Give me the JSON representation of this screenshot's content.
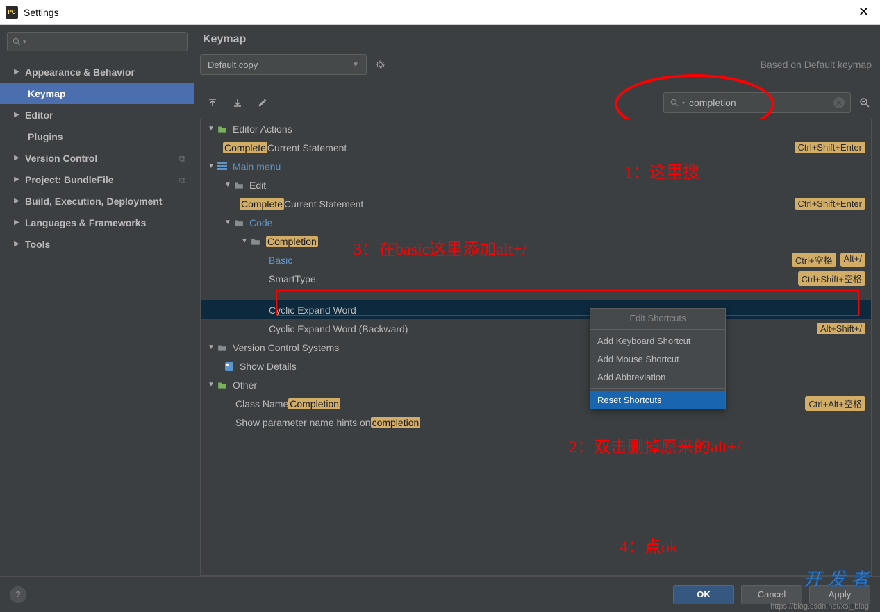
{
  "window": {
    "title": "Settings"
  },
  "sidebar": {
    "items": [
      {
        "label": "Appearance & Behavior",
        "expandable": true,
        "selected": false,
        "level": 0
      },
      {
        "label": "Keymap",
        "expandable": false,
        "selected": true,
        "level": 1
      },
      {
        "label": "Editor",
        "expandable": true,
        "selected": false,
        "level": 0
      },
      {
        "label": "Plugins",
        "expandable": false,
        "selected": false,
        "level": 1
      },
      {
        "label": "Version Control",
        "expandable": true,
        "selected": false,
        "level": 0,
        "doc": true
      },
      {
        "label": "Project: BundleFile",
        "expandable": true,
        "selected": false,
        "level": 0,
        "doc": true
      },
      {
        "label": "Build, Execution, Deployment",
        "expandable": true,
        "selected": false,
        "level": 0
      },
      {
        "label": "Languages & Frameworks",
        "expandable": true,
        "selected": false,
        "level": 0
      },
      {
        "label": "Tools",
        "expandable": true,
        "selected": false,
        "level": 0
      }
    ]
  },
  "keymap": {
    "heading": "Keymap",
    "scheme": "Default copy",
    "basedOn": "Based on Default keymap",
    "search": "completion",
    "tree": {
      "editorActions": {
        "label": "Editor Actions"
      },
      "completeCurrent1": {
        "pre": "",
        "hl": "Complete",
        "post": " Current Statement",
        "shortcut": "Ctrl+Shift+Enter"
      },
      "mainMenu": {
        "label": "Main menu"
      },
      "edit": {
        "label": "Edit"
      },
      "completeCurrent2": {
        "pre": "",
        "hl": "Complete",
        "post": " Current Statement",
        "shortcut": "Ctrl+Shift+Enter"
      },
      "code": {
        "label": "Code"
      },
      "completion": {
        "hl": "Completion"
      },
      "basic": {
        "label": "Basic",
        "shortcut1": "Ctrl+空格",
        "shortcut2": "Alt+/"
      },
      "smartType": {
        "label": "SmartType",
        "shortcut": "Ctrl+Shift+空格"
      },
      "cyclicExpand": {
        "label": "Cyclic Expand Word"
      },
      "cyclicExpandBack": {
        "label": "Cyclic Expand Word (Backward)",
        "shortcut": "Alt+Shift+/"
      },
      "vcs": {
        "label": "Version Control Systems"
      },
      "showDetails": {
        "label": "Show Details"
      },
      "other": {
        "label": "Other"
      },
      "className": {
        "pre": "Class Name ",
        "hl": "Completion",
        "shortcut": "Ctrl+Alt+空格"
      },
      "paramHints": {
        "pre": "Show parameter name hints on ",
        "hl": "completion"
      }
    }
  },
  "contextMenu": {
    "editShortcuts": "Edit Shortcuts",
    "addKeyboard": "Add Keyboard Shortcut",
    "addMouse": "Add Mouse Shortcut",
    "addAbbrev": "Add Abbreviation",
    "reset": "Reset Shortcuts"
  },
  "annotations": {
    "a1": "1：这里搜",
    "a2": "2：双击删掉原来的alt+/",
    "a3": "3：在basic这里添加alt+/",
    "a4": "4：点ok"
  },
  "footer": {
    "ok": "OK",
    "cancel": "Cancel",
    "apply": "Apply",
    "url": "https://blog.csdn.net/xsj_blog"
  },
  "watermark": "开发者"
}
